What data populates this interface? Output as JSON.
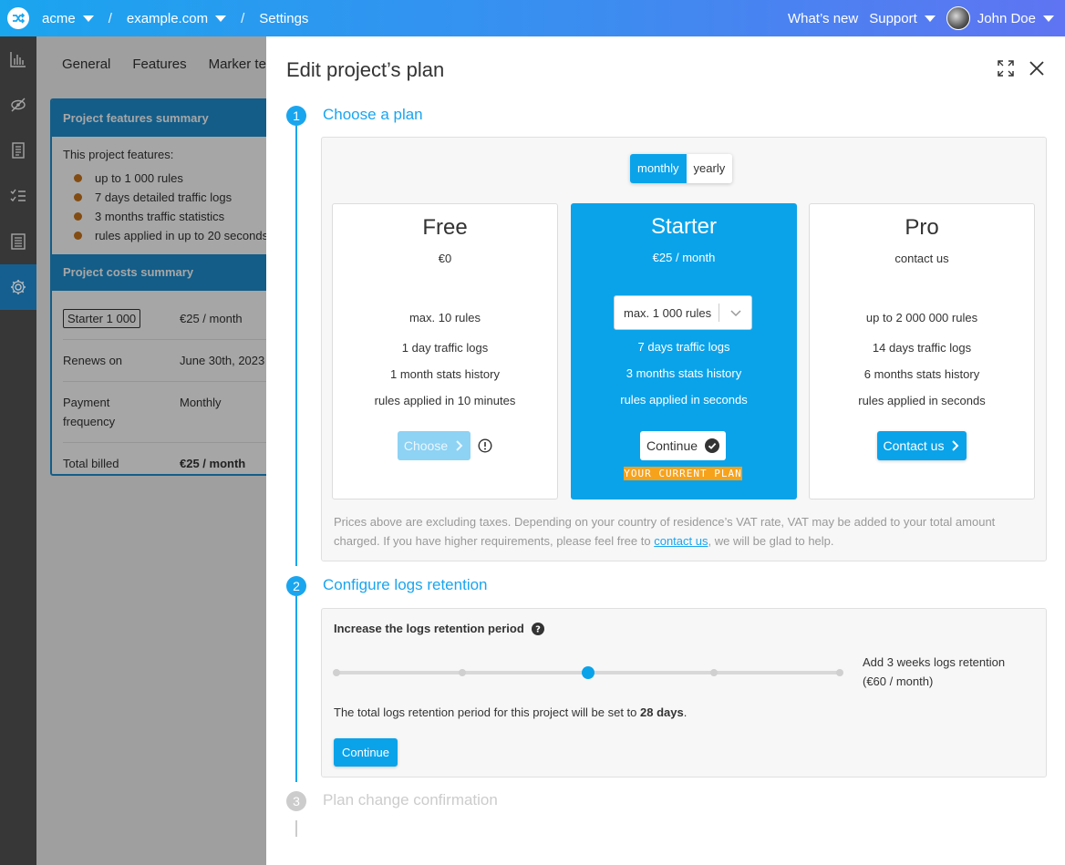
{
  "topbar": {
    "org": "acme",
    "site": "example.com",
    "page": "Settings",
    "whats_new": "What’s new",
    "support": "Support",
    "user": "John Doe"
  },
  "sidebar": {
    "items": [
      {
        "icon": "bar-chart-icon",
        "active": false
      },
      {
        "icon": "no-tracking-icon",
        "active": false
      },
      {
        "icon": "document-icon",
        "active": false
      },
      {
        "icon": "checklist-icon",
        "active": false
      },
      {
        "icon": "list-document-icon",
        "active": false
      },
      {
        "icon": "gear-icon",
        "active": true
      }
    ]
  },
  "background": {
    "tabs": [
      "General",
      "Features",
      "Marker te"
    ],
    "features_title": "Project features summary",
    "features_intro": "This project features:",
    "features": [
      "up to 1 000 rules",
      "7 days detailed traffic logs",
      "3 months traffic statistics",
      "rules applied in up to 20 seconds"
    ],
    "costs_title": "Project costs summary",
    "costs": {
      "plan_tag": "Starter 1 000",
      "plan_price": "€25 / month",
      "renews_label": "Renews on",
      "renews_value": "June 30th, 2023",
      "freq_label": "Payment frequency",
      "freq_value": "Monthly",
      "total_label": "Total billed",
      "total_value": "€25 / month"
    }
  },
  "modal": {
    "title": "Edit project’s plan",
    "steps": [
      {
        "num": "1",
        "label": "Choose a plan",
        "state": "active"
      },
      {
        "num": "2",
        "label": "Configure logs retention",
        "state": "active"
      },
      {
        "num": "3",
        "label": "Plan change confirmation",
        "state": "pending"
      }
    ],
    "billing_toggle": {
      "monthly": "monthly",
      "yearly": "yearly",
      "selected": "monthly"
    },
    "plans": {
      "free": {
        "name": "Free",
        "price": "€0",
        "features": [
          "max. 10 rules",
          "1 day traffic logs",
          "1 month stats history",
          "rules applied in 10 minutes"
        ],
        "button": "Choose"
      },
      "starter": {
        "name": "Starter",
        "price": "€25 / month",
        "select_value": "max. 1 000 rules",
        "features": [
          "7 days traffic logs",
          "3 months stats history",
          "rules applied in seconds"
        ],
        "button": "Continue",
        "badge": "YOUR CURRENT PLAN"
      },
      "pro": {
        "name": "Pro",
        "price": "contact us",
        "features": [
          "up to 2 000 000 rules",
          "14 days traffic logs",
          "6 months stats history",
          "rules applied in seconds"
        ],
        "button": "Contact us"
      }
    },
    "note": {
      "text_before": "Prices above are excluding taxes. Depending on your country of residence’s VAT rate, VAT may be added to your total amount charged. If you have higher requirements, please feel free to ",
      "link": "contact us",
      "text_after": ", we will be glad to help."
    },
    "retention": {
      "heading": "Increase the logs retention period",
      "slider_steps": 5,
      "slider_selected_index": 2,
      "add_label_line1": "Add 3 weeks logs retention",
      "add_label_line2": "(€60 / month)",
      "total_before": "The total logs retention period for this project will be set to ",
      "total_value": "28 days",
      "total_after": ".",
      "button": "Continue"
    }
  },
  "colors": {
    "accent": "#0aa3ea",
    "badge": "#f7a21b",
    "bullet": "#c9761c",
    "sidebar": "#4a4a4a"
  }
}
